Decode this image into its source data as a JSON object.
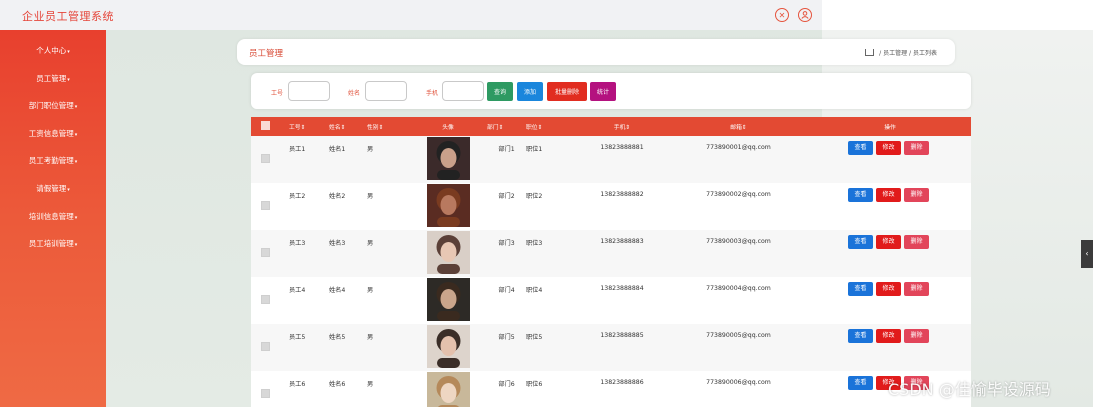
{
  "app": {
    "title": "企业员工管理系统"
  },
  "header_icons": [
    "expand-icon",
    "user-icon"
  ],
  "sidebar": {
    "items": [
      {
        "label": "个人中心"
      },
      {
        "label": "员工管理"
      },
      {
        "label": "部门职位管理"
      },
      {
        "label": "工资信息管理"
      },
      {
        "label": "员工考勤管理"
      },
      {
        "label": "请假管理"
      },
      {
        "label": "培训信息管理"
      },
      {
        "label": "员工培训管理"
      }
    ]
  },
  "panel": {
    "title": "员工管理",
    "breadcrumb": [
      "员工管理",
      "员工列表"
    ],
    "breadcrumb_sep": "/"
  },
  "search": {
    "labels": {
      "job_no": "工号",
      "name": "姓名",
      "phone": "手机"
    },
    "values": {
      "job_no": "",
      "name": "",
      "phone": ""
    },
    "buttons": {
      "query": "查询",
      "add": "添加",
      "batch_delete": "批量删除",
      "stats": "统计"
    },
    "colors": {
      "query": "#2e9a62",
      "add": "#1a86dc",
      "batch_delete": "#e12d20",
      "stats": "#b4127f"
    }
  },
  "table": {
    "headers": [
      "工号⇕",
      "姓名⇕",
      "性别⇕",
      "头像",
      "部门⇕",
      "职位⇕",
      "手机⇕",
      "邮箱⇕",
      "操作"
    ],
    "rows": [
      {
        "job_no": "员工1",
        "name": "姓名1",
        "gender": "男",
        "dept": "部门1",
        "position": "职位1",
        "phone": "13823888881",
        "email": "773890001@qq.com"
      },
      {
        "job_no": "员工2",
        "name": "姓名2",
        "gender": "男",
        "dept": "部门2",
        "position": "职位2",
        "phone": "13823888882",
        "email": "773890002@qq.com"
      },
      {
        "job_no": "员工3",
        "name": "姓名3",
        "gender": "男",
        "dept": "部门3",
        "position": "职位3",
        "phone": "13823888883",
        "email": "773890003@qq.com"
      },
      {
        "job_no": "员工4",
        "name": "姓名4",
        "gender": "男",
        "dept": "部门4",
        "position": "职位4",
        "phone": "13823888884",
        "email": "773890004@qq.com"
      },
      {
        "job_no": "员工5",
        "name": "姓名5",
        "gender": "男",
        "dept": "部门5",
        "position": "职位5",
        "phone": "13823888885",
        "email": "773890005@qq.com"
      },
      {
        "job_no": "员工6",
        "name": "姓名6",
        "gender": "男",
        "dept": "部门6",
        "position": "职位6",
        "phone": "13823888886",
        "email": "773890006@qq.com"
      }
    ],
    "actions": {
      "view": "查看",
      "edit": "修改",
      "delete": "删除"
    }
  },
  "watermark": "CSDN @佳愉毕设源码",
  "colors": {
    "accent": "#e5463a",
    "sidebar": "#ec5a3a",
    "table_header": "#e34a33"
  }
}
